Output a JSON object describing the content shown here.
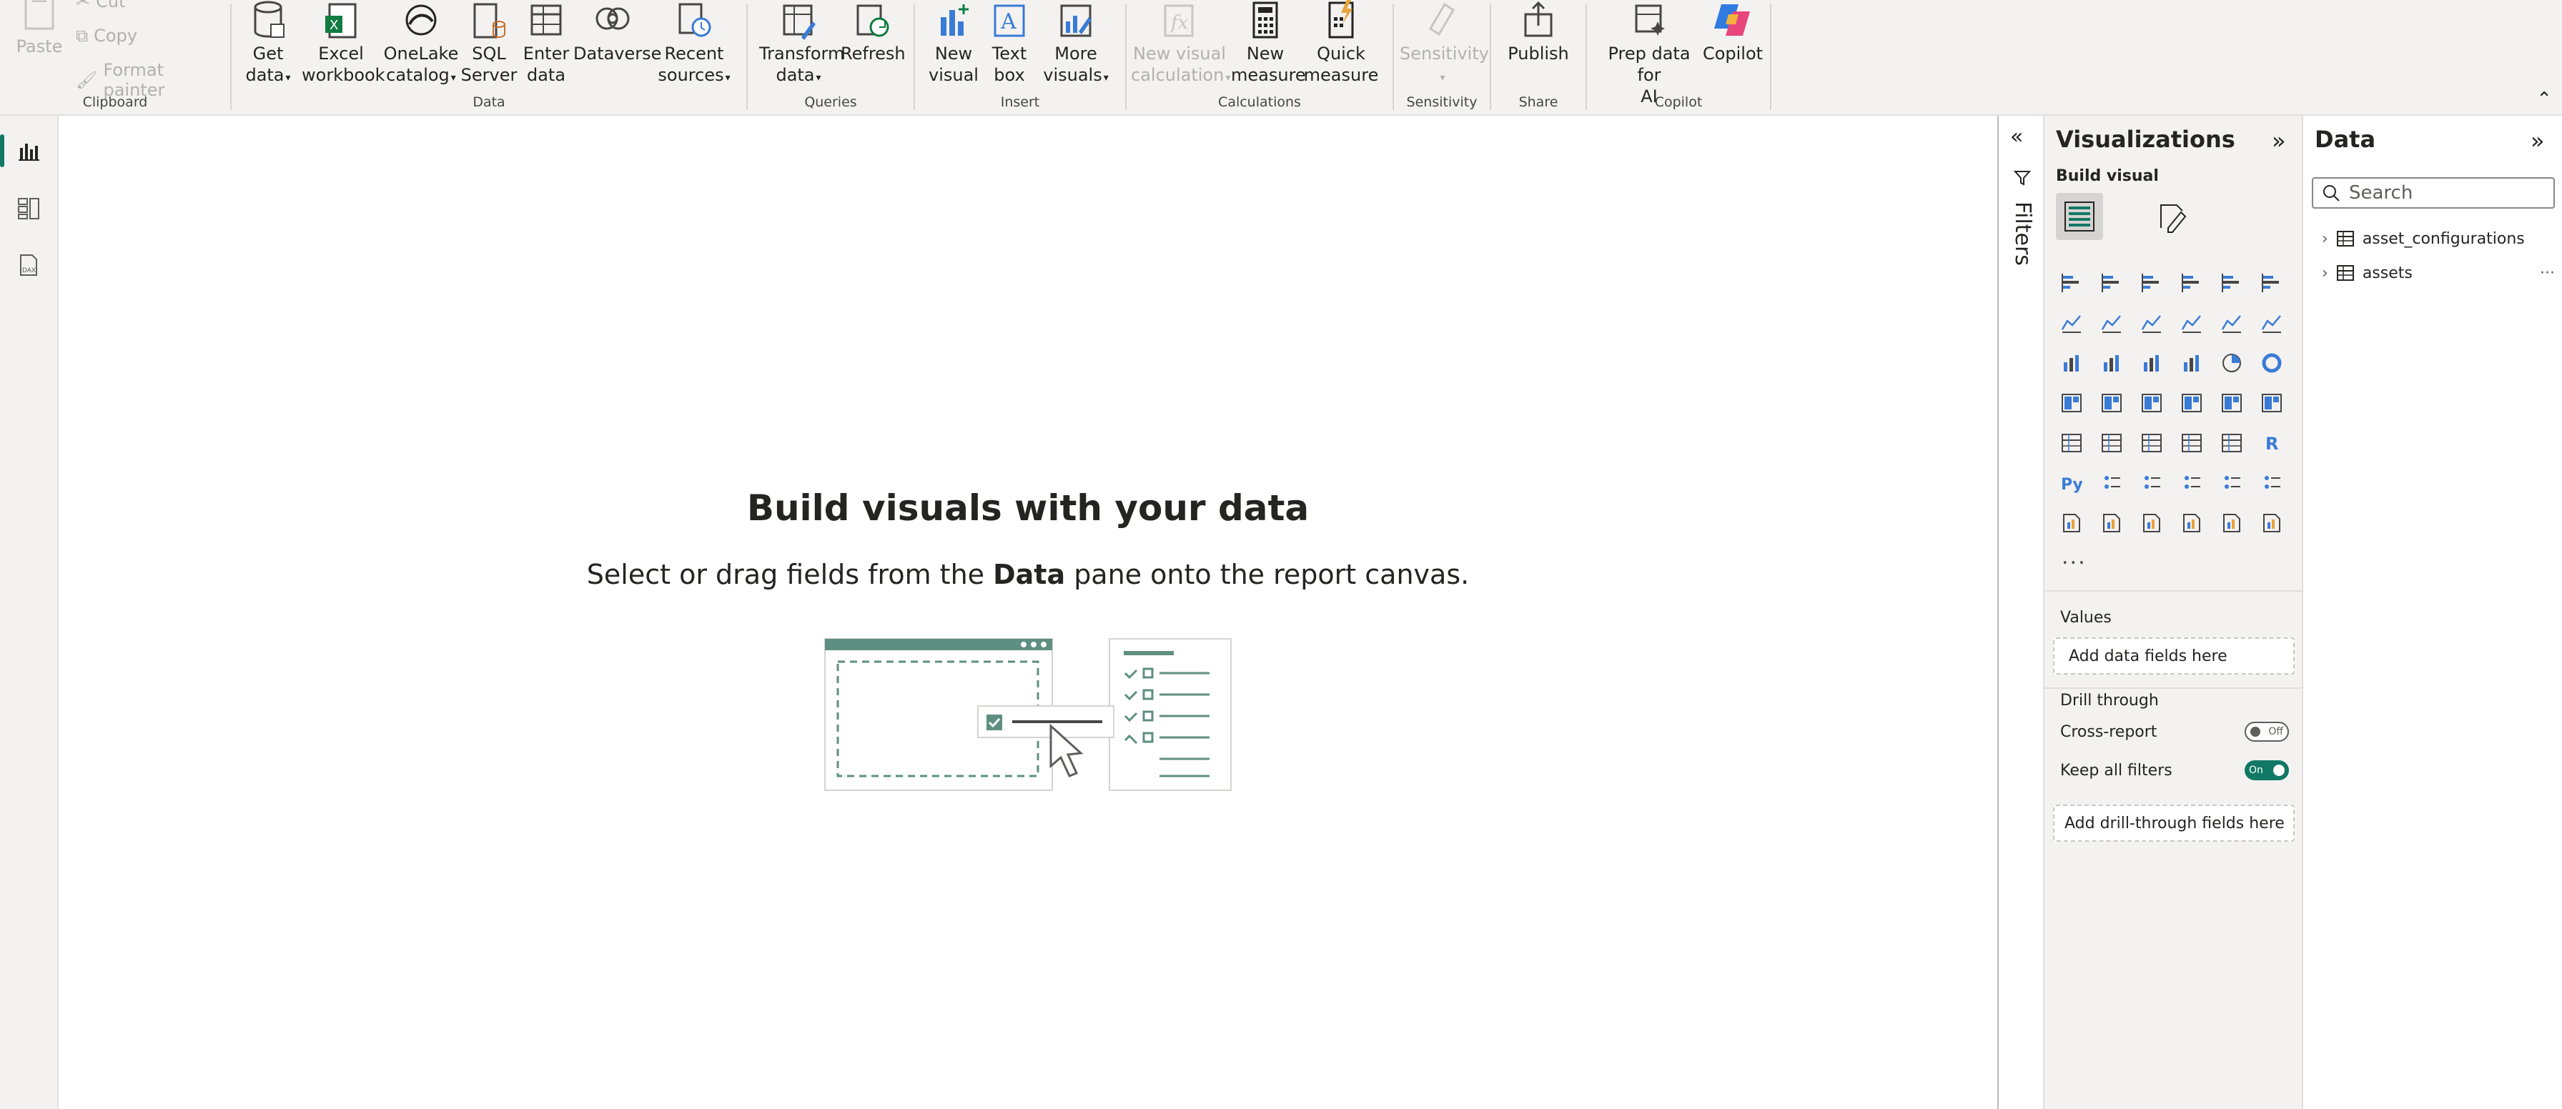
{
  "ribbon": {
    "clipboard": {
      "paste": "Paste",
      "cut": "Cut",
      "copy": "Copy",
      "format_painter": "Format painter",
      "label": "Clipboard"
    },
    "data": {
      "get_data": [
        "Get",
        "data"
      ],
      "excel": [
        "Excel",
        "workbook"
      ],
      "onelake": [
        "OneLake",
        "catalog"
      ],
      "sql": [
        "SQL",
        "Server"
      ],
      "enter": [
        "Enter",
        "data"
      ],
      "dataverse": "Dataverse",
      "recent": [
        "Recent",
        "sources"
      ],
      "label": "Data"
    },
    "queries": {
      "transform": [
        "Transform",
        "data"
      ],
      "refresh": "Refresh",
      "label": "Queries"
    },
    "insert": {
      "new_visual": [
        "New",
        "visual"
      ],
      "text_box": [
        "Text",
        "box"
      ],
      "more_visuals": [
        "More",
        "visuals"
      ],
      "label": "Insert"
    },
    "calculations": {
      "new_visual_calc": [
        "New visual",
        "calculation"
      ],
      "new_measure": [
        "New",
        "measure"
      ],
      "quick_measure": [
        "Quick",
        "measure"
      ],
      "label": "Calculations"
    },
    "sensitivity": {
      "sensitivity": "Sensitivity",
      "label": "Sensitivity"
    },
    "share": {
      "publish": "Publish",
      "label": "Share"
    },
    "copilot": {
      "prep": [
        "Prep data for",
        "AI"
      ],
      "copilot": "Copilot",
      "label": "Copilot"
    }
  },
  "canvas": {
    "title": "Build visuals with your data",
    "sub_before": "Select or drag fields from the ",
    "sub_bold": "Data",
    "sub_after": " pane onto the report canvas."
  },
  "filters": {
    "label": "Filters"
  },
  "visualizations": {
    "title": "Visualizations",
    "build_visual": "Build visual",
    "more": "...",
    "values_label": "Values",
    "values_drop": "Add data fields here",
    "drill_through": "Drill through",
    "cross_report": "Cross-report",
    "cross_report_state": "Off",
    "keep_filters": "Keep all filters",
    "keep_filters_state": "On",
    "drill_drop": "Add drill-through fields here"
  },
  "data_pane": {
    "title": "Data",
    "search_placeholder": "Search",
    "tables": [
      "asset_configurations",
      "assets"
    ],
    "more": "···"
  },
  "colors": {
    "accent": "#117865",
    "ribbon_bg": "#f3f2f1",
    "icon_blue": "#3a7bd5"
  }
}
